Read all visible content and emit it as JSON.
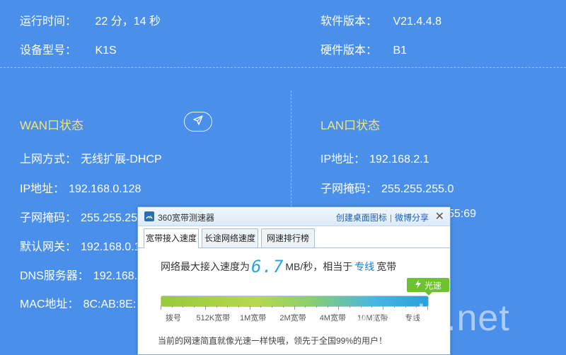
{
  "device": {
    "uptime_label": "运行时间：",
    "uptime_value": "22 分，14 秒",
    "model_label": "设备型号：",
    "model_value": "K1S",
    "software_label": "软件版本：",
    "software_value": "V21.4.4.8",
    "hardware_label": "硬件版本：",
    "hardware_value": "B1"
  },
  "wan": {
    "title": "WAN口状态",
    "rows": [
      {
        "label": "上网方式：",
        "value": "无线扩展-DHCP"
      },
      {
        "label": "IP地址：",
        "value": "192.168.0.128"
      },
      {
        "label": "子网掩码：",
        "value": "255.255.25"
      },
      {
        "label": "默认网关：",
        "value": "192.168.0.1"
      },
      {
        "label": "DNS服务器：",
        "value": "192.168."
      },
      {
        "label": "MAC地址：",
        "value": "8C:AB:8E:"
      }
    ]
  },
  "lan": {
    "title": "LAN口状态",
    "rows": [
      {
        "label": "IP地址：",
        "value": "192.168.2.1"
      },
      {
        "label": "子网掩码：",
        "value": "255.255.255.0"
      },
      {
        "label": "",
        "value": "55:69"
      }
    ]
  },
  "popup": {
    "title": "360宽带测速器",
    "link_desktop": "创建桌面图标",
    "link_divider": "|",
    "link_share": "微博分享",
    "close": "✕",
    "tabs": [
      "宽带接入速度",
      "长途网络速度",
      "网速排行榜"
    ],
    "speed_prefix": "网络最大接入速度为",
    "speed_value": "6.7",
    "speed_unit": "MB/秒",
    "speed_middle": "，相当于",
    "speed_type": "专线",
    "speed_suffix": "宽带",
    "badge_label": "光速",
    "scale_labels": [
      "拨号",
      "512K宽带",
      "1M宽带",
      "2M宽带",
      "4M宽带",
      "10M宽带",
      "专线"
    ],
    "progress_fraction": 1.0,
    "footer": "当前的网速简直就像光速一样快哦，领先于全国99%的用户！"
  },
  "watermark": "acwifi.net",
  "colors": {
    "background": "#4a8fe9",
    "section_title": "#f6e37a",
    "speed_number": "#2aa3dc",
    "badge": "#6ec22f"
  }
}
